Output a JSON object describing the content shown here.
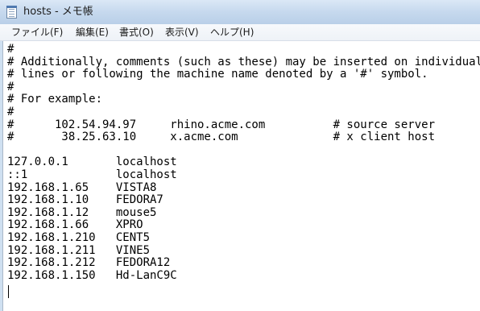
{
  "window": {
    "title": "hosts - メモ帳",
    "icon": "notepad-icon"
  },
  "menu": {
    "file": "ファイル(F)",
    "edit": "編集(E)",
    "format": "書式(O)",
    "view": "表示(V)",
    "help": "ヘルプ(H)"
  },
  "editor": {
    "content": "#\n# Additionally, comments (such as these) may be inserted on individual\n# lines or following the machine name denoted by a '#' symbol.\n#\n# For example:\n#\n#      102.54.94.97     rhino.acme.com          # source server\n#       38.25.63.10     x.acme.com              # x client host\n\n127.0.0.1       localhost\n::1             localhost\n192.168.1.65    VISTA8\n192.168.1.10    FEDORA7\n192.168.1.12    mouse5\n192.168.1.66    XPRO\n192.168.1.210   CENT5\n192.168.1.211   VINE5\n192.168.1.212   FEDORA12\n192.168.1.150   Hd-LanC9C"
  }
}
